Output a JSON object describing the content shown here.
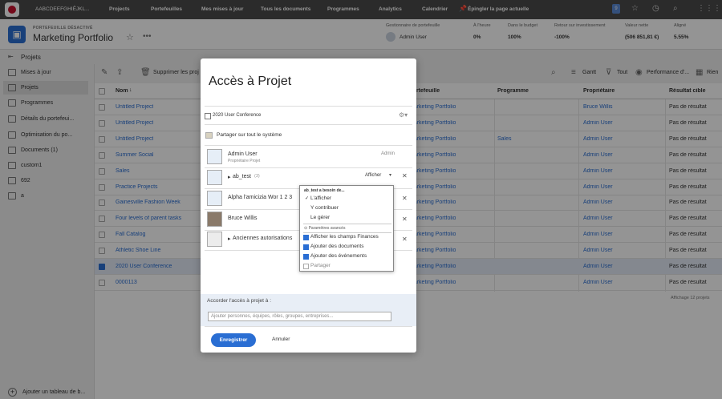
{
  "topnav": {
    "app_name": "AABCDEEFGHIĒJKL...",
    "items": [
      "Projects",
      "Portefeuilles",
      "Mes mises à jour",
      "Tous les documents",
      "Programmes",
      "Analytics",
      "Calendrier"
    ],
    "pin_label": "Épingler la page actuelle",
    "notification_count": "9"
  },
  "header": {
    "subtitle": "PORTEFEUILLE DÉSACTIVÉ",
    "title": "Marketing Portfolio",
    "stats": [
      {
        "label": "Gestionnaire de portefeuille",
        "value": "Admin User"
      },
      {
        "label": "À l'heure",
        "value": "0%"
      },
      {
        "label": "Dans le budget",
        "value": "100%"
      },
      {
        "label": "Retour sur investissement",
        "value": "-100%"
      },
      {
        "label": "Valeur nette",
        "value": "(506 851,81 €)"
      },
      {
        "label": "Aligné",
        "value": "5.55%"
      }
    ]
  },
  "breadcrumb": {
    "label": "Projets"
  },
  "sidebar": {
    "items": [
      "Mises à jour",
      "Projets",
      "Programmes",
      "Détails du portefeui...",
      "Optimisation du po...",
      "Documents (1)",
      "custom1",
      "692",
      "a"
    ],
    "active_index": 1,
    "add_label": "Ajouter un tableau de b..."
  },
  "toolbar": {
    "delete_label": "Supprimer les proj",
    "gantt_label": "Gantt",
    "filter_label": "Tout",
    "view_label": "Performance d'...",
    "group_label": "Rien"
  },
  "grid": {
    "columns": [
      "Nom",
      "Portefeuille",
      "Programme",
      "Propriétaire",
      "Résultat cible"
    ],
    "rows": [
      {
        "name": "Untitled Project",
        "portfolio": "Marketing Portfolio",
        "program": "",
        "owner": "Bruce Willis",
        "result": "Pas de résultat",
        "selected": false
      },
      {
        "name": "Untitled Project",
        "portfolio": "Marketing Portfolio",
        "program": "",
        "owner": "Admin User",
        "result": "Pas de résultat",
        "selected": false
      },
      {
        "name": "Untitled Project",
        "portfolio": "Marketing Portfolio",
        "program": "Sales",
        "owner": "Admin User",
        "result": "Pas de résultat",
        "selected": false
      },
      {
        "name": "Summer Social",
        "portfolio": "Marketing Portfolio",
        "program": "",
        "owner": "Admin User",
        "result": "Pas de résultat",
        "selected": false
      },
      {
        "name": "Sales",
        "portfolio": "Marketing Portfolio",
        "program": "",
        "owner": "Admin User",
        "result": "Pas de résultat",
        "selected": false
      },
      {
        "name": "Practice Projects",
        "portfolio": "Marketing Portfolio",
        "program": "",
        "owner": "Admin User",
        "result": "Pas de résultat",
        "selected": false
      },
      {
        "name": "Gainesville Fashion Week",
        "portfolio": "Marketing Portfolio",
        "program": "",
        "owner": "Admin User",
        "result": "Pas de résultat",
        "selected": false
      },
      {
        "name": "Four levels of parent tasks",
        "portfolio": "Marketing Portfolio",
        "program": "",
        "owner": "Admin User",
        "result": "Pas de résultat",
        "selected": false
      },
      {
        "name": "Fall Catalog",
        "portfolio": "Marketing Portfolio",
        "program": "",
        "owner": "Admin User",
        "result": "Pas de résultat",
        "selected": false
      },
      {
        "name": "Athletic Shoe Line",
        "portfolio": "Marketing Portfolio",
        "program": "",
        "owner": "Admin User",
        "result": "Pas de résultat",
        "selected": false
      },
      {
        "name": "2020 User Conference",
        "portfolio": "Marketing Portfolio",
        "program": "",
        "owner": "Admin User",
        "result": "Pas de résultat",
        "selected": true
      },
      {
        "name": "0000113",
        "portfolio": "Marketing Portfolio",
        "program": "",
        "owner": "Admin User",
        "result": "Pas de résultat",
        "selected": false
      }
    ],
    "footer": "Affichage 12 projets"
  },
  "modal": {
    "title": "Accès à Projet",
    "project_name": "2020 User Conference",
    "share_system_label": "Partager sur tout le système",
    "entries": [
      {
        "name": "Admin User",
        "role": "Propriétaire Projet",
        "access": "Admin",
        "removable": false
      },
      {
        "name": "ab_test",
        "count": "(3)",
        "access": "Afficher",
        "removable": true
      },
      {
        "name": "Alpha l'amicizia Wor 1 2 3",
        "access": "",
        "removable": true
      },
      {
        "name": "Bruce Willis",
        "access": "",
        "removable": true
      },
      {
        "name": "Anciennes autorisations",
        "access": "",
        "removable": true
      }
    ],
    "grant_label": "Accorder l'accès à projet à :",
    "grant_placeholder": "Ajouter personnes, équipes, rôles, groupes, entreprises...",
    "save_label": "Enregistrer",
    "cancel_label": "Annuler"
  },
  "access_dropdown": {
    "header": "ab_test a besoin de...",
    "options": [
      "L'afficher",
      "Y contribuer",
      "Le gérer"
    ],
    "selected_index": 0,
    "advanced_label": "Paramètres avancés",
    "checkboxes": [
      {
        "label": "Afficher les champs Finances",
        "checked": true
      },
      {
        "label": "Ajouter des documents",
        "checked": true
      },
      {
        "label": "Ajouter des événements",
        "checked": true
      },
      {
        "label": "Partager",
        "checked": false
      }
    ]
  },
  "colors": {
    "accent": "#2a6ed3",
    "topnav": "#4a4a4a",
    "selected_row": "#e3ebf6"
  }
}
